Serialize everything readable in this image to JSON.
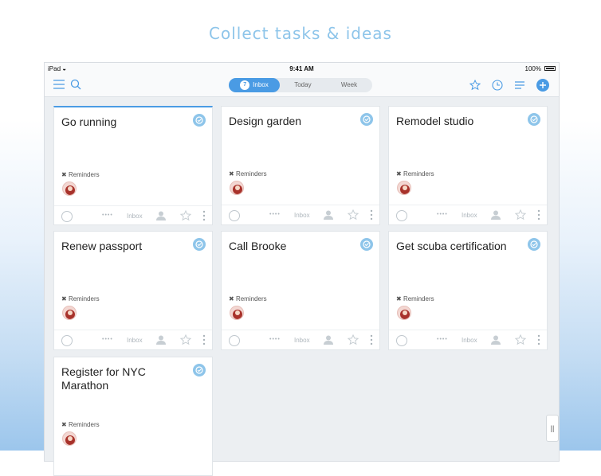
{
  "headline": "Collect tasks & ideas",
  "status": {
    "carrier": "iPad",
    "time": "9:41 AM",
    "battery": "100%"
  },
  "tabs": [
    {
      "label": "Inbox",
      "count": "7",
      "active": true
    },
    {
      "label": "Today",
      "active": false
    },
    {
      "label": "Week",
      "active": false
    }
  ],
  "colors": {
    "accent": "#4a9be4",
    "check": "#8ec5ea",
    "headline": "#8ec5ea"
  },
  "icons": [
    "menu-icon",
    "search-icon",
    "star-icon",
    "clock-icon",
    "list-icon",
    "add-icon"
  ],
  "card_meta": {
    "list_label": "Reminders",
    "location": "Inbox",
    "dots": "••••"
  },
  "cards": [
    {
      "title": "Go running"
    },
    {
      "title": "Design garden"
    },
    {
      "title": "Remodel studio"
    },
    {
      "title": "Renew passport"
    },
    {
      "title": "Call Brooke"
    },
    {
      "title": "Get scuba certification"
    },
    {
      "title": "Register for NYC Marathon"
    }
  ],
  "handle_label": "||"
}
